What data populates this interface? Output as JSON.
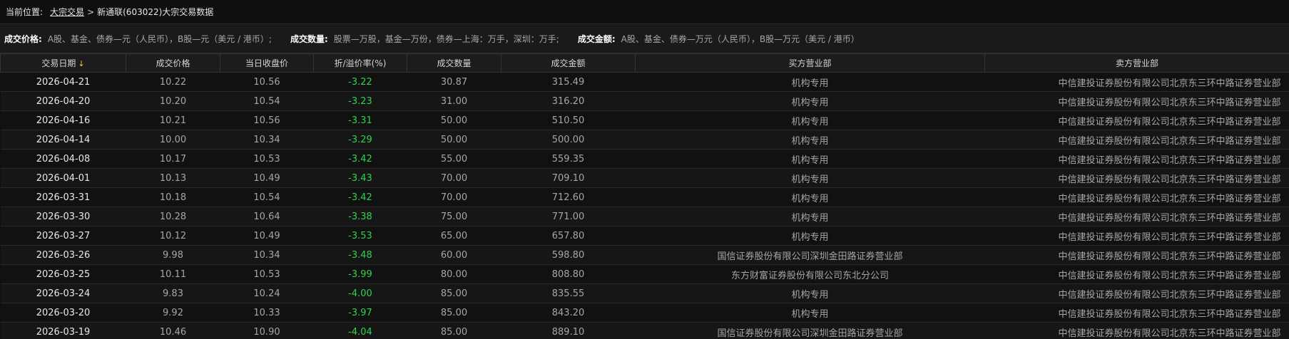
{
  "breadcrumb": {
    "prefix": "当前位置:",
    "link": "大宗交易",
    "separator": ">",
    "current": "新通联(603022)大宗交易数据"
  },
  "legend": {
    "price_label": "成交价格:",
    "price_desc": "A股、基金、债券—元（人民币），B股—元（美元 / 港币）;",
    "volume_label": "成交数量:",
    "volume_desc": "股票—万股，基金—万份，债券—上海：万手，深圳：万手;",
    "amount_label": "成交金额:",
    "amount_desc": "A股、基金、债券—万元（人民币），B股—万元（美元 / 港币）"
  },
  "table": {
    "headers": {
      "date": "交易日期",
      "price": "成交价格",
      "close": "当日收盘价",
      "rate": "折/溢价率(%)",
      "volume": "成交数量",
      "amount": "成交金额",
      "buyer": "买方营业部",
      "seller": "卖方营业部"
    },
    "sort_arrow": "↓",
    "rows": [
      {
        "date": "2026-04-21",
        "price": "10.22",
        "close": "10.56",
        "rate": "-3.22",
        "volume": "30.87",
        "amount": "315.49",
        "buyer": "机构专用",
        "seller": "中信建投证券股份有限公司北京东三环中路证券营业部"
      },
      {
        "date": "2026-04-20",
        "price": "10.20",
        "close": "10.54",
        "rate": "-3.23",
        "volume": "31.00",
        "amount": "316.20",
        "buyer": "机构专用",
        "seller": "中信建投证券股份有限公司北京东三环中路证券营业部"
      },
      {
        "date": "2026-04-16",
        "price": "10.21",
        "close": "10.56",
        "rate": "-3.31",
        "volume": "50.00",
        "amount": "510.50",
        "buyer": "机构专用",
        "seller": "中信建投证券股份有限公司北京东三环中路证券营业部"
      },
      {
        "date": "2026-04-14",
        "price": "10.00",
        "close": "10.34",
        "rate": "-3.29",
        "volume": "50.00",
        "amount": "500.00",
        "buyer": "机构专用",
        "seller": "中信建投证券股份有限公司北京东三环中路证券营业部"
      },
      {
        "date": "2026-04-08",
        "price": "10.17",
        "close": "10.53",
        "rate": "-3.42",
        "volume": "55.00",
        "amount": "559.35",
        "buyer": "机构专用",
        "seller": "中信建投证券股份有限公司北京东三环中路证券营业部"
      },
      {
        "date": "2026-04-01",
        "price": "10.13",
        "close": "10.49",
        "rate": "-3.43",
        "volume": "70.00",
        "amount": "709.10",
        "buyer": "机构专用",
        "seller": "中信建投证券股份有限公司北京东三环中路证券营业部"
      },
      {
        "date": "2026-03-31",
        "price": "10.18",
        "close": "10.54",
        "rate": "-3.42",
        "volume": "70.00",
        "amount": "712.60",
        "buyer": "机构专用",
        "seller": "中信建投证券股份有限公司北京东三环中路证券营业部"
      },
      {
        "date": "2026-03-30",
        "price": "10.28",
        "close": "10.64",
        "rate": "-3.38",
        "volume": "75.00",
        "amount": "771.00",
        "buyer": "机构专用",
        "seller": "中信建投证券股份有限公司北京东三环中路证券营业部"
      },
      {
        "date": "2026-03-27",
        "price": "10.12",
        "close": "10.49",
        "rate": "-3.53",
        "volume": "65.00",
        "amount": "657.80",
        "buyer": "机构专用",
        "seller": "中信建投证券股份有限公司北京东三环中路证券营业部"
      },
      {
        "date": "2026-03-26",
        "price": "9.98",
        "close": "10.34",
        "rate": "-3.48",
        "volume": "60.00",
        "amount": "598.80",
        "buyer": "国信证券股份有限公司深圳金田路证券营业部",
        "seller": "中信建投证券股份有限公司北京东三环中路证券营业部"
      },
      {
        "date": "2026-03-25",
        "price": "10.11",
        "close": "10.53",
        "rate": "-3.99",
        "volume": "80.00",
        "amount": "808.80",
        "buyer": "东方财富证券股份有限公司东北分公司",
        "seller": "中信建投证券股份有限公司北京东三环中路证券营业部"
      },
      {
        "date": "2026-03-24",
        "price": "9.83",
        "close": "10.24",
        "rate": "-4.00",
        "volume": "85.00",
        "amount": "835.55",
        "buyer": "机构专用",
        "seller": "中信建投证券股份有限公司北京东三环中路证券营业部"
      },
      {
        "date": "2026-03-20",
        "price": "9.92",
        "close": "10.33",
        "rate": "-3.97",
        "volume": "85.00",
        "amount": "843.20",
        "buyer": "机构专用",
        "seller": "中信建投证券股份有限公司北京东三环中路证券营业部"
      },
      {
        "date": "2026-03-19",
        "price": "10.46",
        "close": "10.90",
        "rate": "-4.04",
        "volume": "85.00",
        "amount": "889.10",
        "buyer": "国信证券股份有限公司深圳金田路证券营业部",
        "seller": "中信建投证券股份有限公司北京东三环中路证券营业部"
      }
    ]
  },
  "colors": {
    "background": "#0f0f0f",
    "negative_rate": "#2fd34c",
    "sort_arrow": "#f2c94c"
  }
}
